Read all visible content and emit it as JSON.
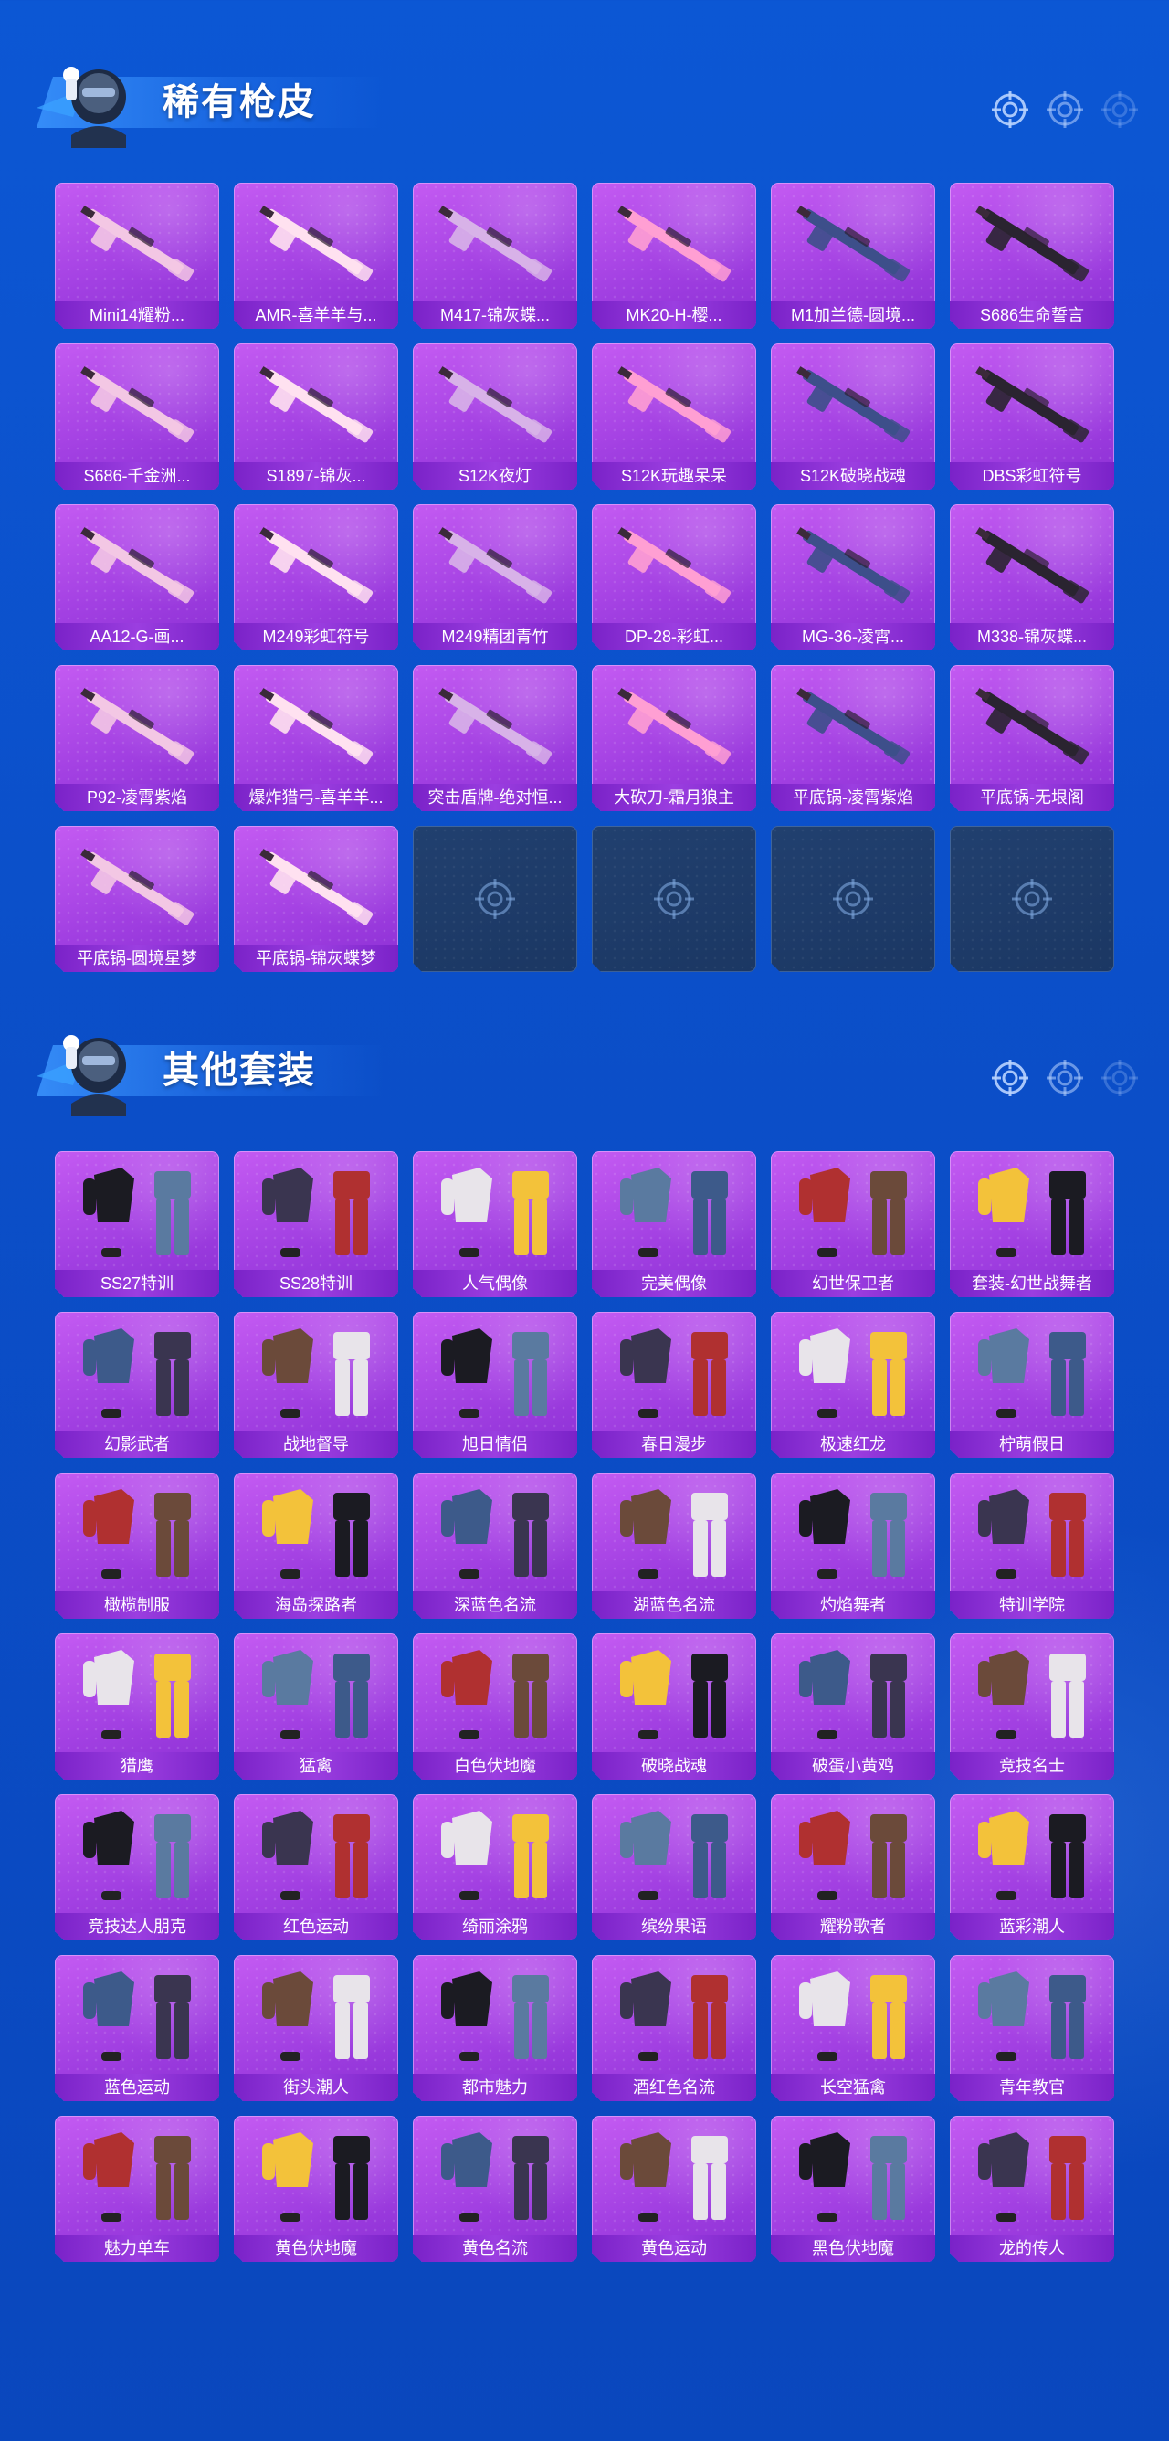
{
  "sections": [
    {
      "id": "guns",
      "title": "稀有枪皮",
      "items": [
        {
          "label": "Mini14耀粉..."
        },
        {
          "label": "AMR-喜羊羊与..."
        },
        {
          "label": "M417-锦灰蝶..."
        },
        {
          "label": "MK20-H-樱..."
        },
        {
          "label": "M1加兰德-圆境..."
        },
        {
          "label": "S686生命誓言"
        },
        {
          "label": "S686-千金洲..."
        },
        {
          "label": "S1897-锦灰..."
        },
        {
          "label": "S12K夜灯"
        },
        {
          "label": "S12K玩趣呆呆"
        },
        {
          "label": "S12K破晓战魂"
        },
        {
          "label": "DBS彩虹符号"
        },
        {
          "label": "AA12-G-画..."
        },
        {
          "label": "M249彩虹符号"
        },
        {
          "label": "M249精团青竹"
        },
        {
          "label": "DP-28-彩虹..."
        },
        {
          "label": "MG-36-凌霄..."
        },
        {
          "label": "M338-锦灰蝶..."
        },
        {
          "label": "P92-凌霄紫焰"
        },
        {
          "label": "爆炸猎弓-喜羊羊..."
        },
        {
          "label": "突击盾牌-绝对恒..."
        },
        {
          "label": "大砍刀-霜月狼主"
        },
        {
          "label": "平底锅-凌霄紫焰"
        },
        {
          "label": "平底锅-无垠阁"
        },
        {
          "label": "平底锅-圆境星梦"
        },
        {
          "label": "平底锅-锦灰蝶梦"
        }
      ],
      "empty_slots": 4
    },
    {
      "id": "suits",
      "title": "其他套装",
      "items": [
        {
          "label": "SS27特训"
        },
        {
          "label": "SS28特训"
        },
        {
          "label": "人气偶像"
        },
        {
          "label": "完美偶像"
        },
        {
          "label": "幻世保卫者"
        },
        {
          "label": "套装-幻世战舞者"
        },
        {
          "label": "幻影武者"
        },
        {
          "label": "战地督导"
        },
        {
          "label": "旭日情侣"
        },
        {
          "label": "春日漫步"
        },
        {
          "label": "极速红龙"
        },
        {
          "label": "柠萌假日"
        },
        {
          "label": "橄榄制服"
        },
        {
          "label": "海岛探路者"
        },
        {
          "label": "深蓝色名流"
        },
        {
          "label": "湖蓝色名流"
        },
        {
          "label": "灼焰舞者"
        },
        {
          "label": "特训学院"
        },
        {
          "label": "猎鹰"
        },
        {
          "label": "猛禽"
        },
        {
          "label": "白色伏地魔"
        },
        {
          "label": "破晓战魂"
        },
        {
          "label": "破蛋小黄鸡"
        },
        {
          "label": "竞技名士"
        },
        {
          "label": "竞技达人朋克"
        },
        {
          "label": "红色运动"
        },
        {
          "label": "绮丽涂鸦"
        },
        {
          "label": "缤纷果语"
        },
        {
          "label": "耀粉歌者"
        },
        {
          "label": "蓝彩潮人"
        },
        {
          "label": "蓝色运动"
        },
        {
          "label": "街头潮人"
        },
        {
          "label": "都市魅力"
        },
        {
          "label": "酒红色名流"
        },
        {
          "label": "长空猛禽"
        },
        {
          "label": "青年教官"
        },
        {
          "label": "魅力单车"
        },
        {
          "label": "黄色伏地魔"
        },
        {
          "label": "黄色名流"
        },
        {
          "label": "黄色运动"
        },
        {
          "label": "黑色伏地魔"
        },
        {
          "label": "龙的传人"
        }
      ],
      "empty_slots": 0
    }
  ],
  "icons": {
    "header_mascot": "mascot-avatar-icon",
    "header_decor": "crosshair-icon",
    "empty_slot": "crosshair-icon",
    "gun_art": "weapon-skin-icon",
    "suit_art": "outfit-icon"
  },
  "colors": {
    "background": "#0b4fc9",
    "card": "#a240e2",
    "card_label": "#7a22c8",
    "empty_card": "#1b3763"
  }
}
